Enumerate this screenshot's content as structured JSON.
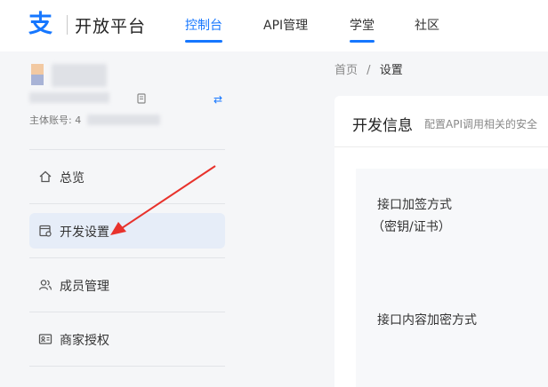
{
  "header": {
    "logo_text": "开放平台",
    "nav": [
      {
        "label": "控制台",
        "active": true
      },
      {
        "label": "API管理",
        "active": false
      },
      {
        "label": "学堂",
        "active": false
      },
      {
        "label": "社区",
        "active": false
      }
    ]
  },
  "sidebar": {
    "account_label": "主体账号: 4",
    "items": [
      {
        "label": "总览",
        "icon": "home-icon"
      },
      {
        "label": "开发设置",
        "icon": "dev-settings-icon",
        "active": true
      },
      {
        "label": "成员管理",
        "icon": "members-icon"
      },
      {
        "label": "商家授权",
        "icon": "id-card-icon"
      }
    ]
  },
  "breadcrumb": {
    "home": "首页",
    "separator": "/",
    "current": "设置"
  },
  "panel": {
    "title": "开发信息",
    "description": "配置API调用相关的安全",
    "fields": [
      {
        "line1": "接口加签方式",
        "line2": "（密钥/证书）"
      },
      {
        "line1": "接口内容加密方式"
      }
    ]
  },
  "colors": {
    "accent": "#1677ff",
    "annotation": "#e8322c"
  }
}
